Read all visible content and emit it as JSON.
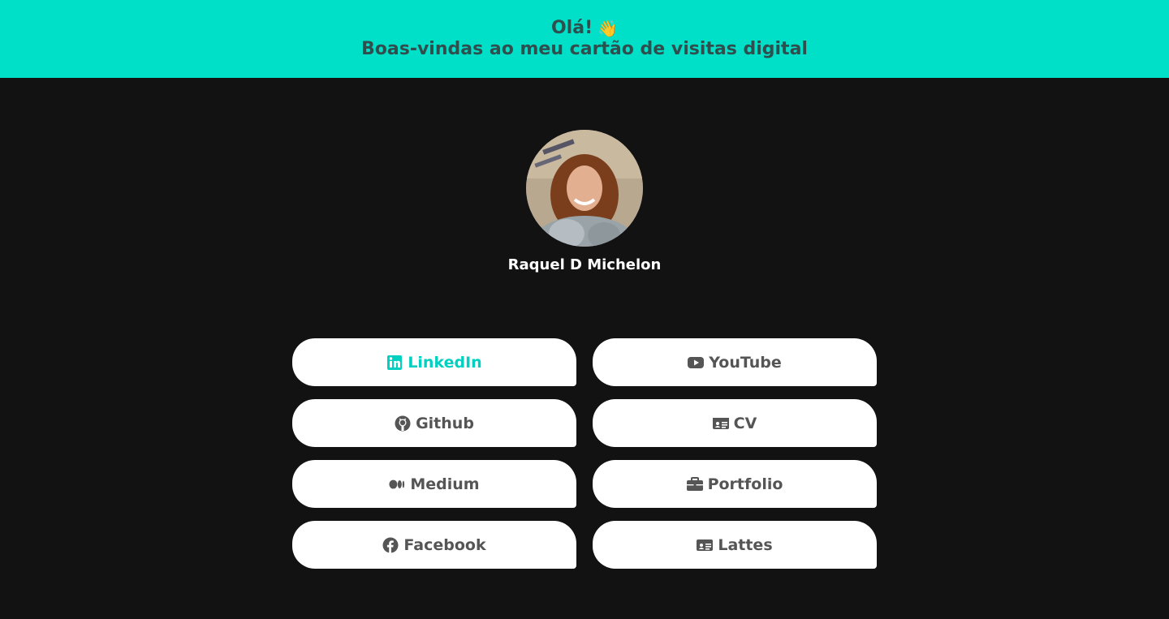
{
  "header": {
    "greeting": "Olá!",
    "wave_emoji": "👋",
    "subtitle": "Boas-vindas ao meu cartão de visitas digital"
  },
  "profile": {
    "name": "Raquel D Michelon"
  },
  "links": [
    {
      "label": "LinkedIn",
      "icon": "linkedin-icon",
      "active": true
    },
    {
      "label": "YouTube",
      "icon": "youtube-icon"
    },
    {
      "label": "Github",
      "icon": "github-icon"
    },
    {
      "label": "CV",
      "icon": "id-card-icon"
    },
    {
      "label": "Medium",
      "icon": "medium-icon"
    },
    {
      "label": "Portfolio",
      "icon": "briefcase-icon"
    },
    {
      "label": "Facebook",
      "icon": "facebook-icon"
    },
    {
      "label": "Lattes",
      "icon": "id-card-icon"
    }
  ],
  "colors": {
    "banner": "#00e0c8",
    "background": "#121212",
    "active_link": "#00d0c0",
    "link_text": "#555555"
  }
}
